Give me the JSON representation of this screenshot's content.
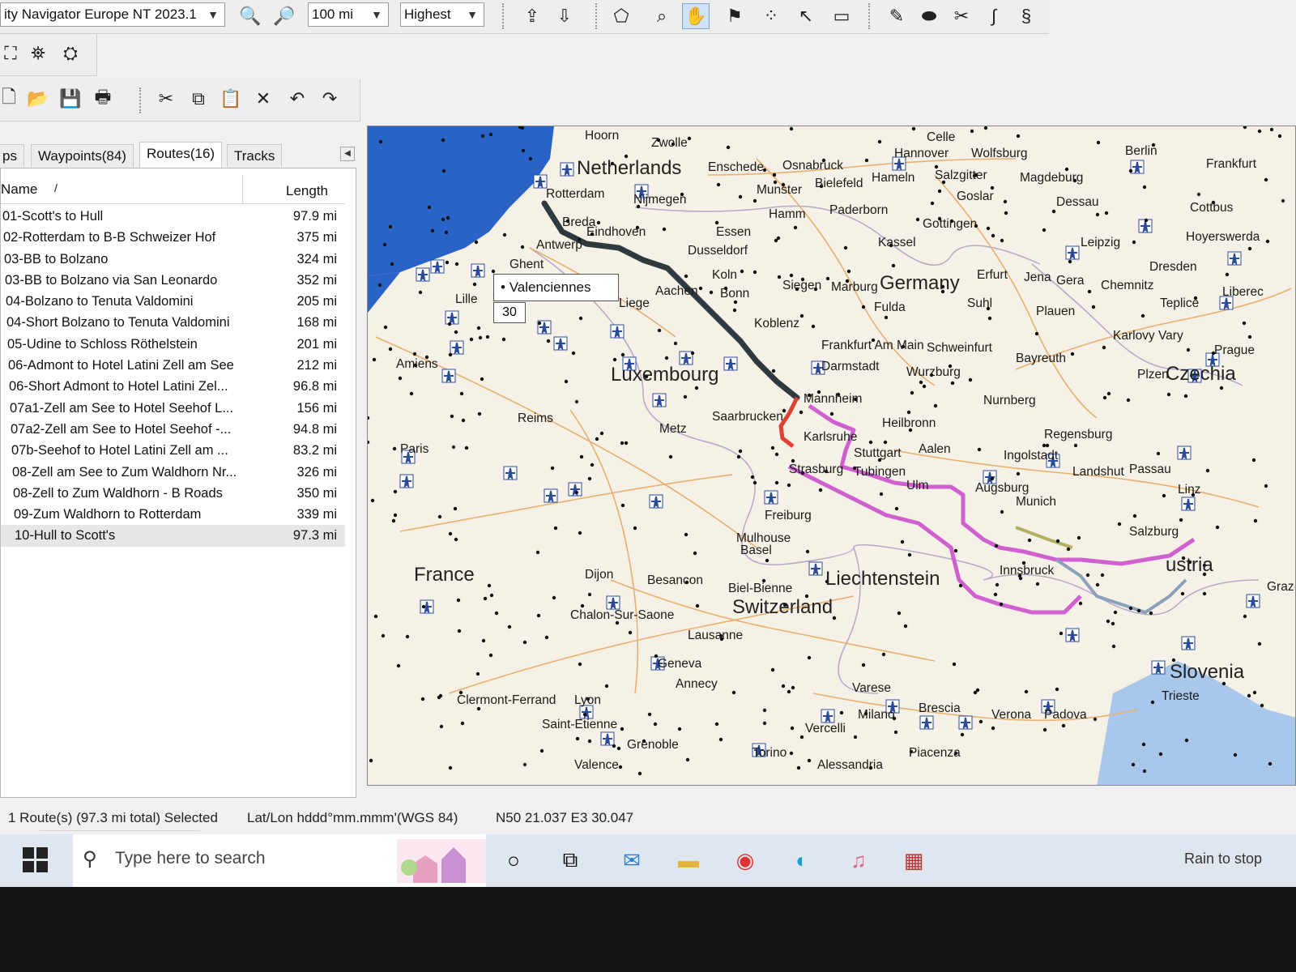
{
  "toolbar": {
    "map_product": "ity Navigator Europe NT 2023.1",
    "scale": "100 mi",
    "detail": "Highest"
  },
  "tabs": [
    {
      "label": "ps"
    },
    {
      "label": "Waypoints(84)"
    },
    {
      "label": "Routes(16)"
    },
    {
      "label": "Tracks"
    }
  ],
  "list": {
    "col_name": "Name",
    "col_length": "Length",
    "rows": [
      {
        "name": "01-Scott's to Hull",
        "length": "97.9 mi"
      },
      {
        "name": "02-Rotterdam to B-B Schweizer Hof",
        "length": "375 mi"
      },
      {
        "name": "03-BB to Bolzano",
        "length": "324 mi"
      },
      {
        "name": "03-BB to Bolzano via San Leonardo",
        "length": "352 mi"
      },
      {
        "name": "04-Bolzano to Tenuta Valdomini",
        "length": "205 mi"
      },
      {
        "name": "04-Short Bolzano to Tenuta Valdomini",
        "length": "168 mi"
      },
      {
        "name": "05-Udine to Schloss Röthelstein",
        "length": "201 mi"
      },
      {
        "name": "06-Admont to Hotel Latini Zell am See",
        "length": "212 mi"
      },
      {
        "name": "06-Short Admont to Hotel Latini Zel...",
        "length": "96.8 mi"
      },
      {
        "name": "07a1-Zell am See to Hotel Seehof L...",
        "length": "156 mi"
      },
      {
        "name": "07a2-Zell am See to Hotel Seehof -...",
        "length": "94.8 mi"
      },
      {
        "name": "07b-Seehof to Hotel Latini Zell am ...",
        "length": "83.2 mi"
      },
      {
        "name": "08-Zell am See to Zum Waldhorn Nr...",
        "length": "326 mi"
      },
      {
        "name": "08-Zell to Zum Waldhorn - B Roads",
        "length": "350 mi"
      },
      {
        "name": "09-Zum Waldhorn to Rotterdam",
        "length": "339 mi"
      },
      {
        "name": "10-Hull to Scott's",
        "length": "97.3 mi"
      }
    ]
  },
  "map": {
    "tooltip_name": "Valenciennes",
    "tooltip_value": "30",
    "countries": [
      {
        "name": "Netherlands"
      },
      {
        "name": "Germany"
      },
      {
        "name": "Luxembourg"
      },
      {
        "name": "France"
      },
      {
        "name": "Switzerland"
      },
      {
        "name": "Liechtenstein"
      },
      {
        "name": "Czechia"
      },
      {
        "name": "Slovenia"
      },
      {
        "name": "ustria"
      }
    ],
    "cities": [
      {
        "name": "Hoorn"
      },
      {
        "name": "Zwolle"
      },
      {
        "name": "Celle"
      },
      {
        "name": "Berlin"
      },
      {
        "name": "Frankfurt"
      },
      {
        "name": "Hannover"
      },
      {
        "name": "Wolfsburg"
      },
      {
        "name": "Enschede"
      },
      {
        "name": "Osnabruck"
      },
      {
        "name": "Bielefeld"
      },
      {
        "name": "Hameln"
      },
      {
        "name": "Salzgitter"
      },
      {
        "name": "Magdeburg"
      },
      {
        "name": "Munster"
      },
      {
        "name": "Goslar"
      },
      {
        "name": "Dessau"
      },
      {
        "name": "Cottbus"
      },
      {
        "name": "Rotterdam"
      },
      {
        "name": "Nijmegen"
      },
      {
        "name": "Hamm"
      },
      {
        "name": "Paderborn"
      },
      {
        "name": "Gottingen"
      },
      {
        "name": "Hoyerswerda"
      },
      {
        "name": "Breda"
      },
      {
        "name": "Eindhoven"
      },
      {
        "name": "Essen"
      },
      {
        "name": "Kassel"
      },
      {
        "name": "Leipzig"
      },
      {
        "name": "Antwerp"
      },
      {
        "name": "Dusseldorf"
      },
      {
        "name": "Dresden"
      },
      {
        "name": "Ghent"
      },
      {
        "name": "Koln"
      },
      {
        "name": "Erfurt"
      },
      {
        "name": "Jena"
      },
      {
        "name": "Gera"
      },
      {
        "name": "Chemnitz"
      },
      {
        "name": "Liberec"
      },
      {
        "name": "Aachen"
      },
      {
        "name": "Bonn"
      },
      {
        "name": "Siegen"
      },
      {
        "name": "Marburg"
      },
      {
        "name": "Lille"
      },
      {
        "name": "Liege"
      },
      {
        "name": "Fulda"
      },
      {
        "name": "Suhl"
      },
      {
        "name": "Teplice"
      },
      {
        "name": "Plauen"
      },
      {
        "name": "Koblenz"
      },
      {
        "name": "Karlovy Vary"
      },
      {
        "name": "Amiens"
      },
      {
        "name": "Frankfurt Am Main"
      },
      {
        "name": "Schweinfurt"
      },
      {
        "name": "Prague"
      },
      {
        "name": "Darmstadt"
      },
      {
        "name": "Bayreuth"
      },
      {
        "name": "Wurzburg"
      },
      {
        "name": "Plzen"
      },
      {
        "name": "Mannheim"
      },
      {
        "name": "Nurnberg"
      },
      {
        "name": "Reims"
      },
      {
        "name": "Saarbrucken"
      },
      {
        "name": "Heilbronn"
      },
      {
        "name": "Metz"
      },
      {
        "name": "Karlsruhe"
      },
      {
        "name": "Regensburg"
      },
      {
        "name": "Stuttgart"
      },
      {
        "name": "Aalen"
      },
      {
        "name": "Ingolstadt"
      },
      {
        "name": "Paris"
      },
      {
        "name": "Strasburg"
      },
      {
        "name": "Tubingen"
      },
      {
        "name": "Ulm"
      },
      {
        "name": "Landshut"
      },
      {
        "name": "Passau"
      },
      {
        "name": "Augsburg"
      },
      {
        "name": "Munich"
      },
      {
        "name": "Linz"
      },
      {
        "name": "Freiburg"
      },
      {
        "name": "Salzburg"
      },
      {
        "name": "Mulhouse"
      },
      {
        "name": "Basel"
      },
      {
        "name": "Innsbruck"
      },
      {
        "name": "Dijon"
      },
      {
        "name": "Besancon"
      },
      {
        "name": "Biel-Bienne"
      },
      {
        "name": "Graz"
      },
      {
        "name": "Chalon-Sur-Saone"
      },
      {
        "name": "Lausanne"
      },
      {
        "name": "Geneva"
      },
      {
        "name": "Annecy"
      },
      {
        "name": "Varese"
      },
      {
        "name": "Trieste"
      },
      {
        "name": "Clermont-Ferrand"
      },
      {
        "name": "Lyon"
      },
      {
        "name": "Brescia"
      },
      {
        "name": "Milano"
      },
      {
        "name": "Verona"
      },
      {
        "name": "Padova"
      },
      {
        "name": "Saint-Etienne"
      },
      {
        "name": "Vercelli"
      },
      {
        "name": "Grenoble"
      },
      {
        "name": "Torino"
      },
      {
        "name": "Piacenza"
      },
      {
        "name": "Valence"
      },
      {
        "name": "Alessandria"
      }
    ]
  },
  "status": {
    "selection": "1 Route(s) (97.3 mi total) Selected",
    "format": "Lat/Lon hddd°mm.mmm'(WGS 84)",
    "position": "N50 21.037 E3 30.047"
  },
  "taskbar": {
    "search_placeholder": "Type here to search",
    "weather": "Rain to stop"
  },
  "colors": {
    "route_selected": "#2f3a3f",
    "route_alt": "#d060d0",
    "route_red": "#e04030",
    "water": "#2a63c8",
    "land": "#f6f1e6"
  }
}
